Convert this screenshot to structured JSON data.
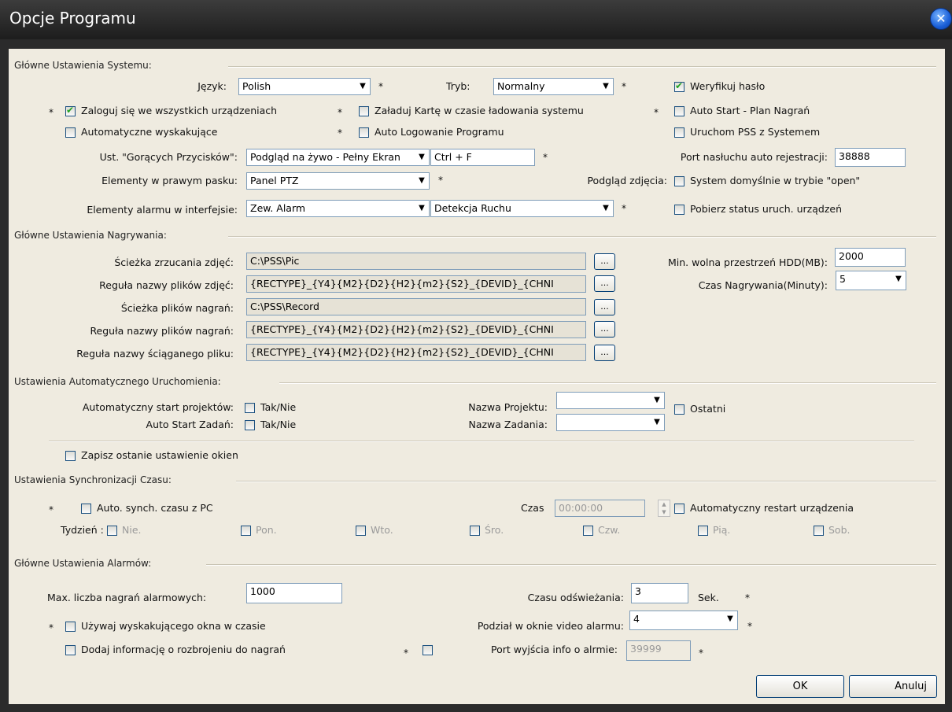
{
  "window": {
    "title": "Opcje Programu",
    "close_glyph": "✕"
  },
  "system": {
    "group_title": "Główne Ustawienia Systemu:",
    "lang_label": "Język:",
    "lang_value": "Polish",
    "mode_label": "Tryb:",
    "mode_value": "Normalny",
    "verify_password": "Weryfikuj hasło",
    "login_all_devices": "Zaloguj się we wszystkich urządzeniach",
    "load_card": "Załaduj Kartę w czasie ładowania systemu",
    "auto_start_plan": "Auto Start - Plan Nagrań",
    "auto_popup": "Automatyczne wyskakujące okno w czasie",
    "auto_login": "Auto Logowanie Programu",
    "run_with_system": "Uruchom PSS z Systemem",
    "hotkeys_label": "Ust. \"Gorących Przycisków\":",
    "hotkeys_value": "Podgląd na żywo - Pełny Ekran",
    "hotkeys_combo": "Ctrl + F",
    "port_label": "Port nasłuchu auto rejestracji:",
    "port_value": "38888",
    "right_bar_label": "Elementy w prawym pasku:",
    "right_bar_value": "Panel PTZ",
    "preview_label": "Podgląd zdjęcia:",
    "open_default": "System domyślnie w trybie \"open\"",
    "alarm_items_label": "Elementy alarmu w interfejsie:",
    "alarm_items_value1": "Zew. Alarm",
    "alarm_items_value2": "Detekcja Ruchu",
    "fetch_status": "Pobierz status uruch. urządzeń",
    "star": "*"
  },
  "recording": {
    "group_title": "Główne Ustawienia Nagrywania:",
    "pic_path_label": "Ścieżka zrzucania zdjęć:",
    "pic_path_value": "C:\\PSS\\Pic",
    "pic_rule_label": "Reguła nazwy plików zdjęć:",
    "pic_rule_value": "{RECTYPE}_{Y4}{M2}{D2}{H2}{m2}{S2}_{DEVID}_{CHNI",
    "rec_path_label": "Ścieżka plików nagrań:",
    "rec_path_value": "C:\\PSS\\Record",
    "rec_rule_label": "Reguła nazwy plików nagrań:",
    "rec_rule_value": "{RECTYPE}_{Y4}{M2}{D2}{H2}{m2}{S2}_{DEVID}_{CHNI",
    "dl_rule_label": "Reguła nazwy ściąganego pliku:",
    "dl_rule_value": "{RECTYPE}_{Y4}{M2}{D2}{H2}{m2}{S2}_{DEVID}_{CHNI",
    "browse": "...",
    "min_space_label": "Min. wolna przestrzeń HDD(MB):",
    "min_space_value": "2000",
    "rec_time_label": "Czas Nagrywania(Minuty):",
    "rec_time_value": "5"
  },
  "autostart": {
    "group_title": "Ustawienia Automatycznego Uruchomienia:",
    "auto_projects_label": "Automatyczny start projektów:",
    "auto_tasks_label": "Auto Start Zadań:",
    "yes_no": "Tak/Nie",
    "project_name_label": "Nazwa Projektu:",
    "task_name_label": "Nazwa Zadania:",
    "last": "Ostatni",
    "save_window": "Zapisz ostanie ustawienie okien"
  },
  "sync": {
    "group_title": "Ustawienia Synchronizacji Czasu:",
    "auto_sync": "Auto. synch. czasu z PC",
    "time_label": "Czas",
    "time_value": "00:00:00",
    "auto_restart": "Automatyczny restart urządzenia",
    "week_label": "Tydzień :",
    "days": [
      "Nie.",
      "Pon.",
      "Wto.",
      "Śro.",
      "Czw.",
      "Pią.",
      "Sob."
    ]
  },
  "alarms": {
    "group_title": "Główne Ustawienia Alarmów:",
    "max_label": "Max. liczba nagrań alarmowych:",
    "max_value": "1000",
    "refresh_label": "Czasu odświeżania:",
    "refresh_value": "3",
    "sec": "Sek.",
    "use_popup": "Używaj wyskakującego okna w czasie video alarmu",
    "split_label": "Podział w oknie video alarmu:",
    "split_value": "4",
    "add_disarm": "Dodaj informację o rozbrojeniu do nagrań",
    "port_out_label": "Port wyjścia info o alrmie:",
    "port_out_value": "39999"
  },
  "buttons": {
    "ok": "OK",
    "cancel": "Anuluj"
  }
}
